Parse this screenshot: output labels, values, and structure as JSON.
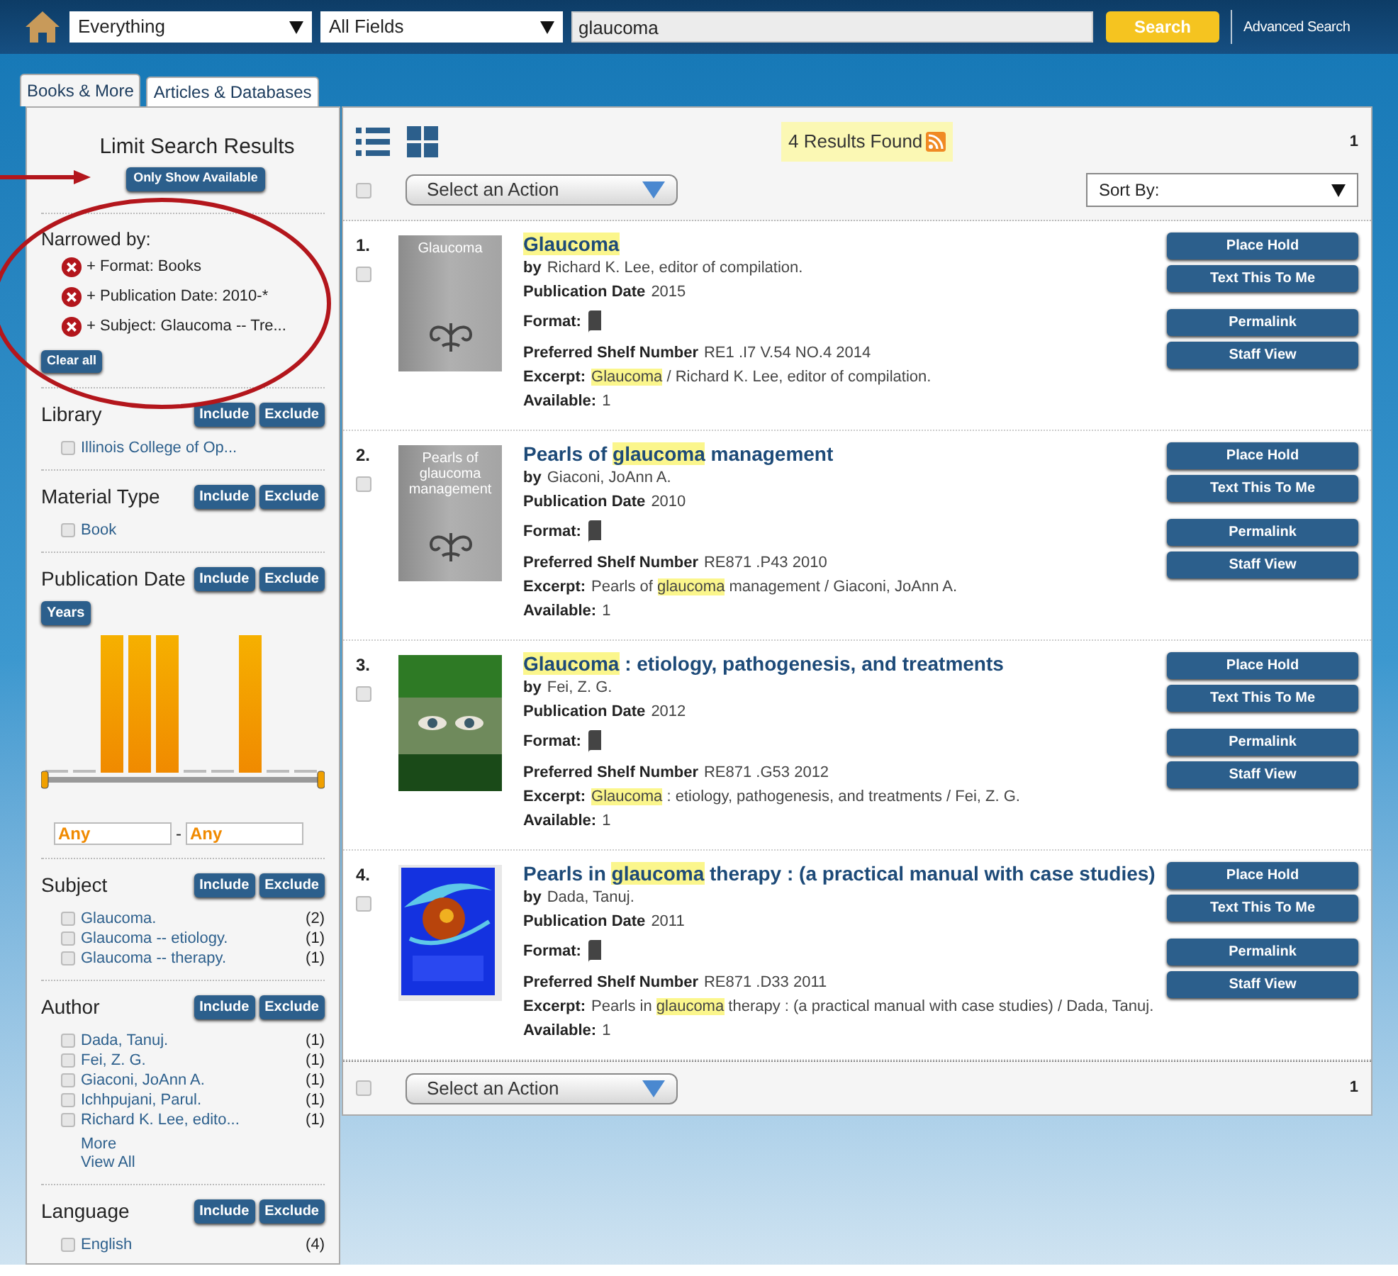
{
  "header": {
    "scope": "Everything",
    "field": "All Fields",
    "query": "glaucoma",
    "search_button": "Search",
    "advanced_link": "Advanced Search"
  },
  "tabs": [
    {
      "label": "Books & More",
      "selected": true
    },
    {
      "label": "Articles & Databases",
      "selected": false
    }
  ],
  "sidebar": {
    "title": "Limit Search Results",
    "available_button": "Only Show Available",
    "narrowed_heading": "Narrowed by:",
    "filters": [
      "+ Format: Books",
      "+ Publication Date: 2010-*",
      "+ Subject: Glaucoma -- Tre..."
    ],
    "clear_button": "Clear all",
    "facets": [
      {
        "kind": "list",
        "title": "Library",
        "include": "Include",
        "exclude": "Exclude",
        "items": [
          {
            "label": "Illinois College of Op...",
            "checked": false
          }
        ]
      },
      {
        "kind": "list",
        "title": "Material Type",
        "include": "Include",
        "exclude": "Exclude",
        "items": [
          {
            "label": "Book",
            "checked": false
          }
        ]
      },
      {
        "kind": "range",
        "title": "Publication Date",
        "include": "Include",
        "exclude": "Exclude",
        "years_button": "Years",
        "from": "Any",
        "separator": "-",
        "to": "Any"
      },
      {
        "kind": "list",
        "title": "Subject",
        "include": "Include",
        "exclude": "Exclude",
        "items": [
          {
            "label": "Glaucoma.",
            "count": "(2)",
            "checked": false
          },
          {
            "label": "Glaucoma -- etiology.",
            "count": "(1)",
            "checked": false
          },
          {
            "label": "Glaucoma -- therapy.",
            "count": "(1)",
            "checked": false
          }
        ]
      },
      {
        "kind": "list",
        "title": "Author",
        "include": "Include",
        "exclude": "Exclude",
        "items": [
          {
            "label": "Dada, Tanuj.",
            "count": "(1)",
            "checked": false
          },
          {
            "label": "Fei, Z. G.",
            "count": "(1)",
            "checked": false
          },
          {
            "label": "Giaconi, JoAnn A.",
            "count": "(1)",
            "checked": false
          },
          {
            "label": "Ichhpujani, Parul.",
            "count": "(1)",
            "checked": false
          },
          {
            "label": "Richard K. Lee, edito...",
            "count": "(1)",
            "checked": false
          }
        ],
        "links": [
          "More",
          "View All"
        ]
      },
      {
        "kind": "list",
        "title": "Language",
        "include": "Include",
        "exclude": "Exclude",
        "items": [
          {
            "label": "English",
            "count": "(4)",
            "checked": false
          }
        ]
      }
    ]
  },
  "results": {
    "count_text": "4 Results Found",
    "page": "1",
    "select_all_checked": false,
    "bottom_select_all_checked": false,
    "action_select": "Select an Action",
    "sort_select": "Sort By:",
    "items": [
      {
        "number": "1.",
        "checked": false,
        "cover": {
          "kind": "generic",
          "text": "Glaucoma"
        },
        "title": [
          {
            "text": "Glaucoma",
            "highlight": true
          }
        ],
        "fields": [
          {
            "kind": "text",
            "label": "by",
            "value": "Richard K. Lee, editor of compilation."
          },
          {
            "kind": "text",
            "label": "Publication Date",
            "value": "2015"
          },
          {
            "kind": "format",
            "label": "Format:"
          },
          {
            "kind": "text",
            "label": "Preferred Shelf Number",
            "value": "RE1 .I7 V.54 NO.4 2014"
          },
          {
            "kind": "excerpt",
            "label": "Excerpt:",
            "parts": [
              {
                "text": "Glaucoma",
                "highlight": true
              },
              {
                "text": " / Richard K. Lee, editor of compilation.",
                "highlight": false
              }
            ]
          },
          {
            "kind": "text",
            "label": "Available:",
            "value": "1"
          }
        ],
        "buttons": [
          "Place Hold",
          "Text This To Me",
          "Permalink",
          "Staff View"
        ]
      },
      {
        "number": "2.",
        "checked": false,
        "cover": {
          "kind": "generic",
          "text": "Pearls of glaucoma management"
        },
        "title": [
          {
            "text": "Pearls of ",
            "highlight": false
          },
          {
            "text": "glaucoma",
            "highlight": true
          },
          {
            "text": " management",
            "highlight": false
          }
        ],
        "fields": [
          {
            "kind": "text",
            "label": "by",
            "value": "Giaconi, JoAnn A."
          },
          {
            "kind": "text",
            "label": "Publication Date",
            "value": "2010"
          },
          {
            "kind": "format",
            "label": "Format:"
          },
          {
            "kind": "text",
            "label": "Preferred Shelf Number",
            "value": "RE871 .P43 2010"
          },
          {
            "kind": "excerpt",
            "label": "Excerpt:",
            "parts": [
              {
                "text": "Pearls of ",
                "highlight": false
              },
              {
                "text": "glaucoma",
                "highlight": true
              },
              {
                "text": " management / Giaconi, JoAnn A.",
                "highlight": false
              }
            ]
          },
          {
            "kind": "text",
            "label": "Available:",
            "value": "1"
          }
        ],
        "buttons": [
          "Place Hold",
          "Text This To Me",
          "Permalink",
          "Staff View"
        ]
      },
      {
        "number": "3.",
        "checked": false,
        "cover": {
          "kind": "picture"
        },
        "title": [
          {
            "text": "Glaucoma",
            "highlight": true
          },
          {
            "text": " : etiology, pathogenesis, and treatments",
            "highlight": false
          }
        ],
        "fields": [
          {
            "kind": "text",
            "label": "by",
            "value": "Fei, Z. G."
          },
          {
            "kind": "text",
            "label": "Publication Date",
            "value": "2012"
          },
          {
            "kind": "format",
            "label": "Format:"
          },
          {
            "kind": "text",
            "label": "Preferred Shelf Number",
            "value": "RE871 .G53 2012"
          },
          {
            "kind": "excerpt",
            "label": "Excerpt:",
            "parts": [
              {
                "text": "Glaucoma",
                "highlight": true
              },
              {
                "text": " : etiology, pathogenesis, and treatments / Fei, Z. G.",
                "highlight": false
              }
            ]
          },
          {
            "kind": "text",
            "label": "Available:",
            "value": "1"
          }
        ],
        "buttons": [
          "Place Hold",
          "Text This To Me",
          "Permalink",
          "Staff View"
        ]
      },
      {
        "number": "4.",
        "checked": false,
        "cover": {
          "kind": "picture"
        },
        "title": [
          {
            "text": "Pearls in ",
            "highlight": false
          },
          {
            "text": "glaucoma",
            "highlight": true
          },
          {
            "text": " therapy : (a practical manual with case studies)",
            "highlight": false
          }
        ],
        "fields": [
          {
            "kind": "text",
            "label": "by",
            "value": "Dada, Tanuj."
          },
          {
            "kind": "text",
            "label": "Publication Date",
            "value": "2011"
          },
          {
            "kind": "format",
            "label": "Format:"
          },
          {
            "kind": "text",
            "label": "Preferred Shelf Number",
            "value": "RE871 .D33 2011"
          },
          {
            "kind": "excerpt",
            "label": "Excerpt:",
            "parts": [
              {
                "text": "Pearls in ",
                "highlight": false
              },
              {
                "text": "glaucoma",
                "highlight": true
              },
              {
                "text": " therapy : (a practical manual with case studies) / Dada, Tanuj.",
                "highlight": false
              }
            ]
          },
          {
            "kind": "text",
            "label": "Available:",
            "value": "1"
          }
        ],
        "buttons": [
          "Place Hold",
          "Text This To Me",
          "Permalink",
          "Staff View"
        ]
      }
    ],
    "bottom_action_select": "Select an Action",
    "bottom_page": "1"
  }
}
